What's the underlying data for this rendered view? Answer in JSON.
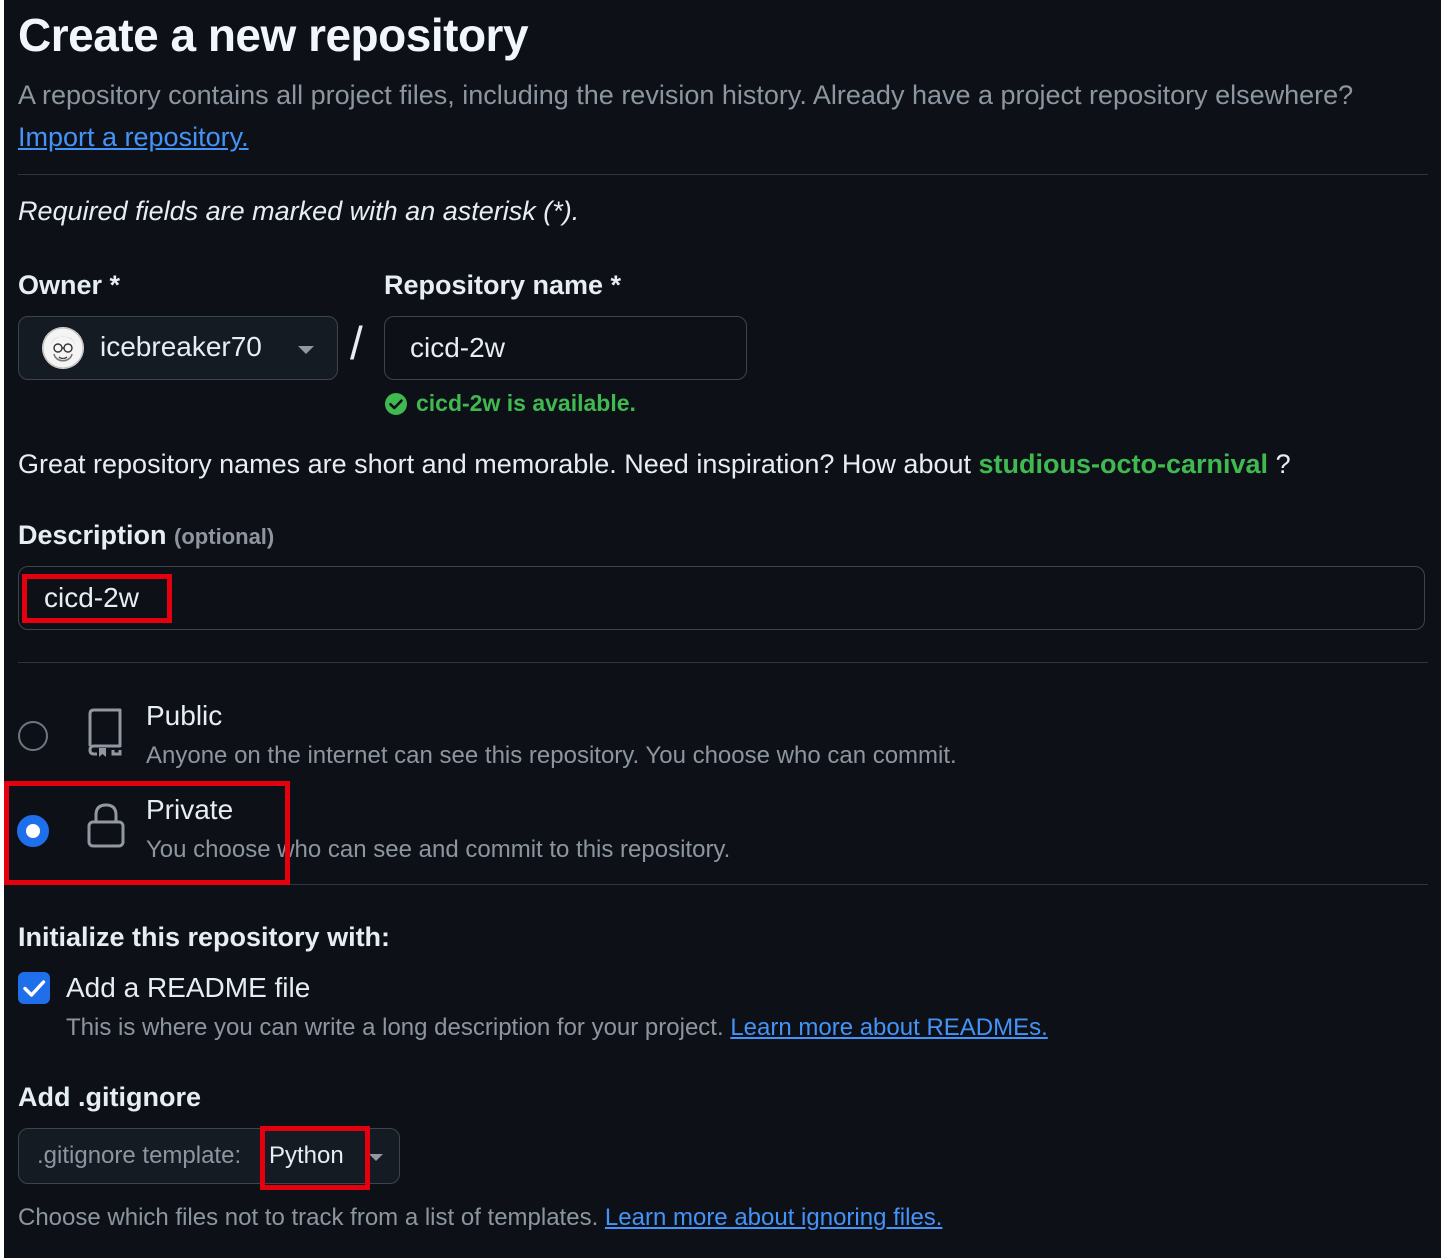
{
  "header": {
    "title": "Create a new repository",
    "intro": "A repository contains all project files, including the revision history. Already have a project repository elsewhere?",
    "import_link": "Import a repository."
  },
  "required_note": "Required fields are marked with an asterisk (*).",
  "owner": {
    "label": "Owner *",
    "value": "icebreaker70",
    "icon": "chevron-down-icon"
  },
  "separator": "/",
  "repo_name": {
    "label": "Repository name *",
    "value": "cicd-2w",
    "availability": "cicd-2w is available."
  },
  "inspiration": {
    "text": "Great repository names are short and memorable. Need inspiration? How about",
    "suggestion": "studious-octo-carnival",
    "suffix": "?"
  },
  "description": {
    "label": "Description",
    "optional": "(optional)",
    "value": "cicd-2w"
  },
  "visibility": {
    "options": [
      {
        "title": "Public",
        "description": "Anyone on the internet can see this repository. You choose who can commit.",
        "selected": false,
        "icon": "repo-icon"
      },
      {
        "title": "Private",
        "description": "You choose who can see and commit to this repository.",
        "selected": true,
        "icon": "lock-icon"
      }
    ]
  },
  "initialize": {
    "heading": "Initialize this repository with:",
    "readme": {
      "label": "Add a README file",
      "checked": true,
      "description": "This is where you can write a long description for your project.",
      "link": "Learn more about READMEs."
    }
  },
  "gitignore": {
    "label": "Add .gitignore",
    "select_prefix": ".gitignore template:",
    "select_value": "Python",
    "help": "Choose which files not to track from a list of templates.",
    "link": "Learn more about ignoring files."
  },
  "colors": {
    "background": "#0d1117",
    "accent": "#1f6feb",
    "link": "#4493f8",
    "success": "#3fb950",
    "highlight": "#e5000f"
  }
}
